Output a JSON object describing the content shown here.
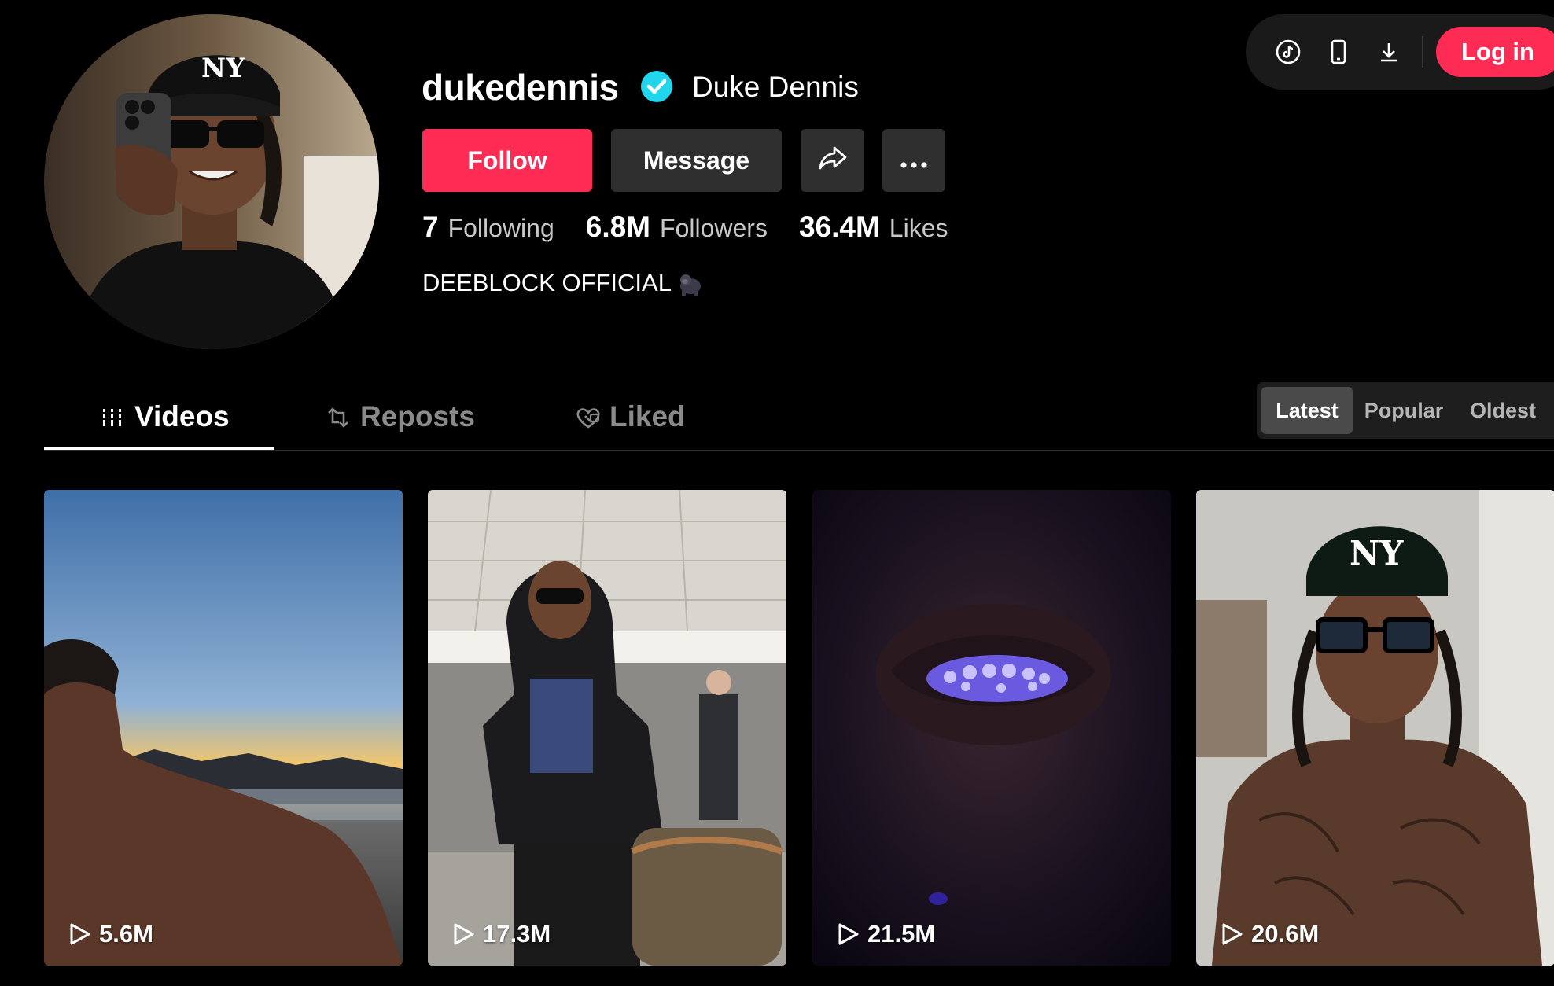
{
  "profile": {
    "username": "dukedennis",
    "display_name": "Duke Dennis",
    "verified": true,
    "bio": "DEEBLOCK OFFICIAL",
    "bio_emoji": "gorilla-emoji",
    "avatar_icon": "avatar"
  },
  "actions": {
    "follow_label": "Follow",
    "message_label": "Message",
    "share_icon": "share-icon",
    "more_icon": "more-icon"
  },
  "stats": {
    "following_count": "7",
    "following_label": "Following",
    "followers_count": "6.8M",
    "followers_label": "Followers",
    "likes_count": "36.4M",
    "likes_label": "Likes"
  },
  "top_bar": {
    "icons": [
      "tiktok-icon",
      "mobile-icon",
      "download-icon"
    ],
    "login_label": "Log in"
  },
  "tabs": [
    {
      "label": "Videos",
      "icon": "grid-icon",
      "active": true
    },
    {
      "label": "Reposts",
      "icon": "repost-icon",
      "active": false
    },
    {
      "label": "Liked",
      "icon": "heart-icon",
      "active": false
    }
  ],
  "sort": {
    "options": [
      "Latest",
      "Popular",
      "Oldest"
    ],
    "selected": "Latest"
  },
  "videos": [
    {
      "views": "5.6M"
    },
    {
      "views": "17.3M"
    },
    {
      "views": "21.5M"
    },
    {
      "views": "20.6M"
    }
  ],
  "colors": {
    "accent": "#fe2c55",
    "verified": "#20d5ec",
    "background": "#000000",
    "secondary_button": "#2f2f2f"
  }
}
